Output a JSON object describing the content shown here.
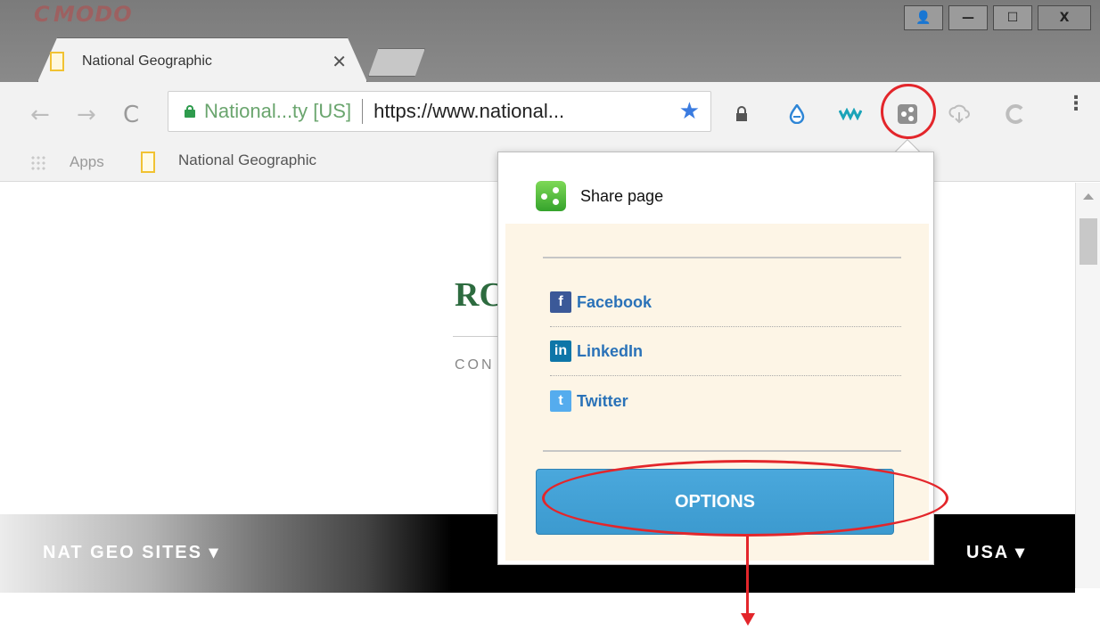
{
  "window": {
    "brand": "MODO",
    "brand_initial": "C",
    "tab_title": "National Geographic",
    "tab_close": "✕",
    "controls": {
      "user": "👤",
      "minimize": "—",
      "maximize": "☐",
      "close": "X"
    }
  },
  "toolbar": {
    "back": "←",
    "forward": "→",
    "reload": "C",
    "ev_label": "National...ty [US]",
    "url": "https://www.national...",
    "star": "★",
    "menu": "⋮",
    "extensions": [
      "lock-icon",
      "droplet-icon",
      "wave-icon",
      "share-page-icon",
      "download-icon",
      "comodo-c-icon"
    ]
  },
  "bookmarks": {
    "apps": "Apps",
    "items": [
      "National Geographic"
    ]
  },
  "page": {
    "heading_fragment": "RC",
    "sub_fragment": "CON",
    "nav_left": "NAT GEO SITES ▾",
    "nav_right": "USA ▾"
  },
  "popup": {
    "title": "Share page",
    "links": [
      {
        "label": "Facebook",
        "icon": "facebook-icon",
        "icon_text": "f",
        "color": "#3b5998"
      },
      {
        "label": "LinkedIn",
        "icon": "linkedin-icon",
        "icon_text": "in",
        "color": "#0e76a8"
      },
      {
        "label": "Twitter",
        "icon": "twitter-icon",
        "icon_text": "t",
        "color": "#55acee"
      }
    ],
    "options_label": "OPTIONS"
  },
  "colors": {
    "accent_red": "#e3262b",
    "link_blue": "#2a72b8",
    "button_blue": "#3c9acf",
    "popup_cream": "#fdf5e6"
  }
}
